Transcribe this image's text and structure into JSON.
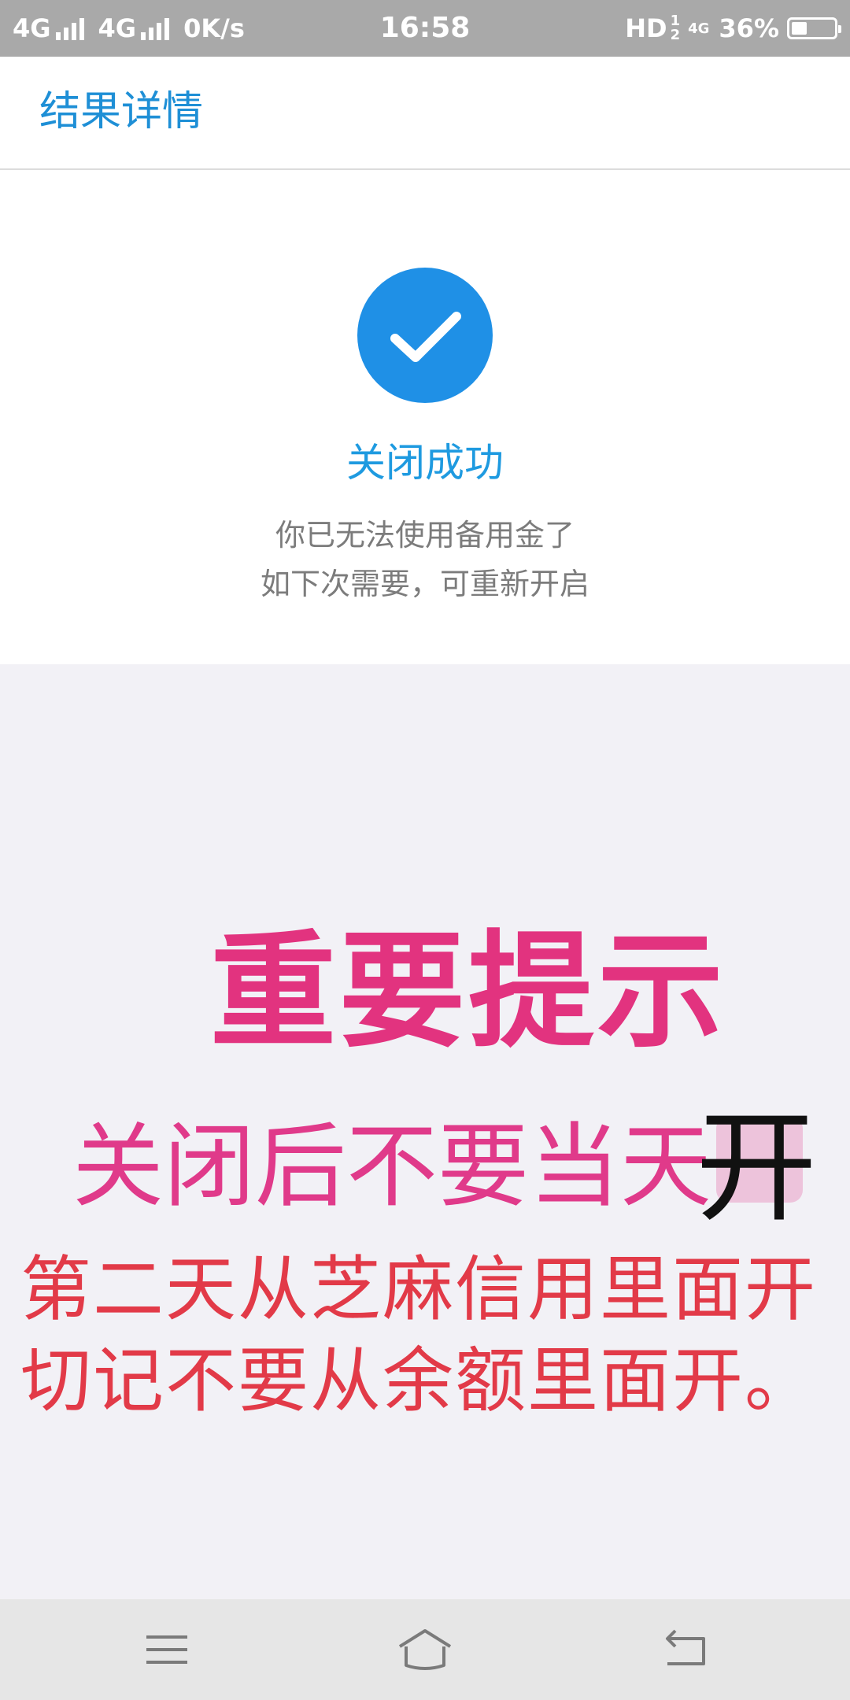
{
  "status_bar": {
    "net1": "4G",
    "net2": "4G",
    "speed": "0K/s",
    "time": "16:58",
    "hd": "HD",
    "hd_top": "1",
    "hd_bottom": "2",
    "mini_net": "4G",
    "battery": "36%",
    "battery_level": 0.36
  },
  "app_bar": {
    "title": "结果详情"
  },
  "result": {
    "title": "关闭成功",
    "desc_line1": "你已无法使用备用金了",
    "desc_line2": "如下次需要，可重新开启",
    "accent_color": "#1f90e6"
  },
  "notice": {
    "title": "重要提示",
    "line1": "关闭后不要当天",
    "overlay_char": "开",
    "line2": "第二天从芝麻信用里面开",
    "line3": "切记不要从余额里面开。"
  },
  "nav_bar": {
    "items": [
      {
        "icon": "menu-icon"
      },
      {
        "icon": "home-icon"
      },
      {
        "icon": "back-icon"
      }
    ]
  }
}
